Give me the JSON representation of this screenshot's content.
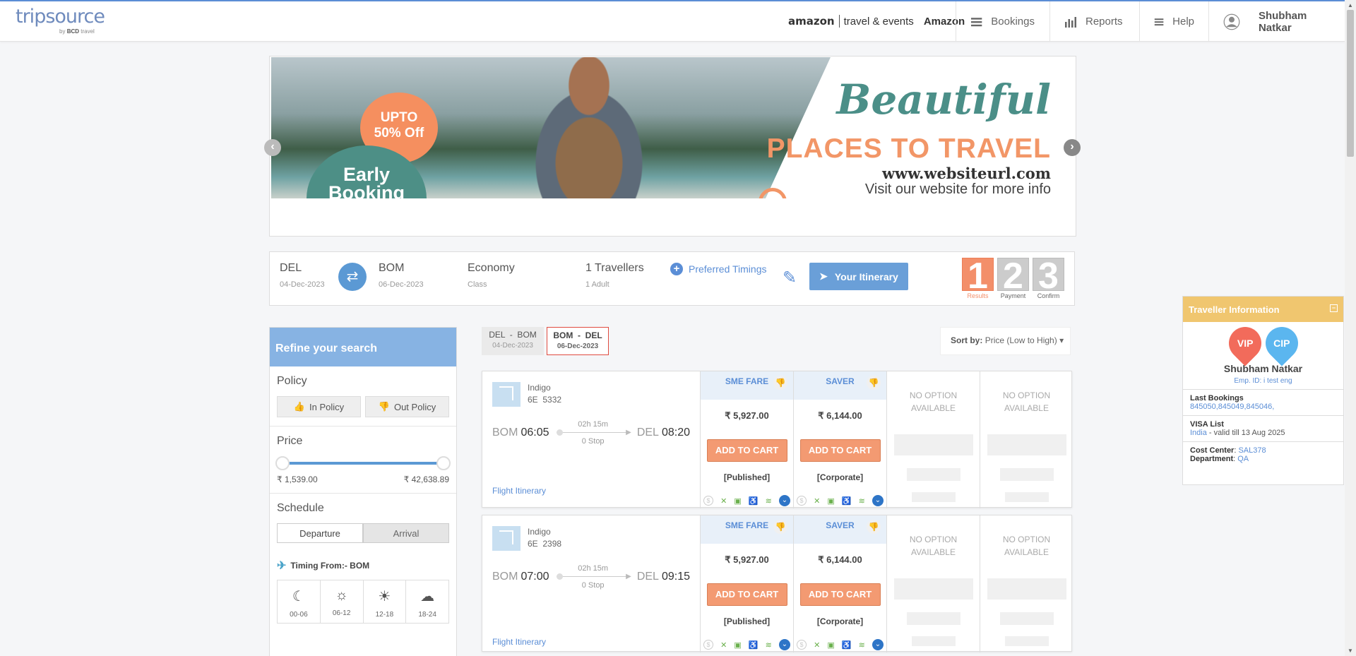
{
  "header": {
    "logo_text": "tripsource",
    "logo_sub_by": "by",
    "logo_sub_brand": "BCD",
    "logo_sub_travel": "travel",
    "company_brand": "amazon",
    "company_division": "travel & events",
    "company_name": "Amazon",
    "nav": [
      {
        "label": "Bookings",
        "icon": "menu-icon"
      },
      {
        "label": "Reports",
        "icon": "bar-chart-icon"
      },
      {
        "label": "Help",
        "icon": "menu-icon"
      }
    ],
    "user_name": "Shubham Natkar"
  },
  "banner": {
    "discount_line1": "UPTO",
    "discount_line2": "50% Off",
    "early_line1": "Early",
    "early_line2": "Booking",
    "headline": "Beautiful",
    "subheadline": "PLACES TO TRAVEL",
    "url": "www.websiteurl.com",
    "cta": "Visit our website for more info"
  },
  "search": {
    "from": "DEL",
    "from_date": "04-Dec-2023",
    "to": "BOM",
    "to_date": "06-Dec-2023",
    "class": "Economy",
    "class_label": "Class",
    "travellers": "1 Travellers",
    "travellers_detail": "1 Adult",
    "preferred_timings": "Preferred Timings",
    "itinerary_button": "Your Itinerary"
  },
  "steps": [
    {
      "num": "1",
      "label": "Results",
      "active": true
    },
    {
      "num": "2",
      "label": "Payment",
      "active": false
    },
    {
      "num": "3",
      "label": "Confirm",
      "active": false
    }
  ],
  "refine": {
    "title": "Refine your search",
    "policy_title": "Policy",
    "in_policy": "In Policy",
    "out_policy": "Out Policy",
    "price_title": "Price",
    "price_min": "₹ 1,539.00",
    "price_max": "₹ 42,638.89",
    "schedule_title": "Schedule",
    "departure": "Departure",
    "arrival": "Arrival",
    "timing_from": "Timing From:- BOM",
    "slots": [
      "00-06",
      "06-12",
      "12-18",
      "18-24"
    ]
  },
  "tabs": [
    {
      "route": "DEL  -  BOM",
      "date": "04-Dec-2023",
      "active": false
    },
    {
      "route": "BOM  -  DEL",
      "date": "06-Dec-2023",
      "active": true
    }
  ],
  "sort": {
    "label": "Sort by:",
    "value": "Price (Low to High)"
  },
  "flights": [
    {
      "airline": "Indigo",
      "flight_no": "6E  5332",
      "from": "BOM",
      "dep": "06:05",
      "duration": "02h 15m",
      "stops": "0 Stop",
      "to": "DEL",
      "arr": "08:20",
      "itinerary_link": "Flight Itinerary",
      "fares": [
        {
          "name": "SME FARE",
          "price": "₹ 5,927.00",
          "button": "ADD TO CART",
          "tag": "[Published]"
        },
        {
          "name": "SAVER",
          "price": "₹ 6,144.00",
          "button": "ADD TO CART",
          "tag": "[Corporate]"
        }
      ],
      "no_option": [
        "NO OPTION AVAILABLE",
        "NO OPTION AVAILABLE"
      ]
    },
    {
      "airline": "Indigo",
      "flight_no": "6E  2398",
      "from": "BOM",
      "dep": "07:00",
      "duration": "02h 15m",
      "stops": "0 Stop",
      "to": "DEL",
      "arr": "09:15",
      "itinerary_link": "Flight Itinerary",
      "fares": [
        {
          "name": "SME FARE",
          "price": "₹ 5,927.00",
          "button": "ADD TO CART",
          "tag": "[Published]"
        },
        {
          "name": "SAVER",
          "price": "₹ 6,144.00",
          "button": "ADD TO CART",
          "tag": "[Corporate]"
        }
      ],
      "no_option": [
        "NO OPTION AVAILABLE",
        "NO OPTION AVAILABLE"
      ]
    }
  ],
  "traveller": {
    "title": "Traveller Information",
    "vip": "VIP",
    "cip": "CIP",
    "name": "Shubham Natkar",
    "emp_id": "Emp. ID: i test eng",
    "last_bookings_label": "Last Bookings",
    "last_bookings": "845050,845049,845046,",
    "visa_label": "VISA List",
    "visa_country": "India",
    "visa_validity": " - valid till 13 Aug 2025",
    "cost_center_label": "Cost Center",
    "cost_center": "SAL378",
    "department_label": "Department",
    "department": "QA"
  },
  "colors": {
    "accent_blue": "#5b8ed6",
    "cta_orange": "#f39a72",
    "panel_yellow": "#f0c66f",
    "refine_blue": "#87b3e3"
  }
}
